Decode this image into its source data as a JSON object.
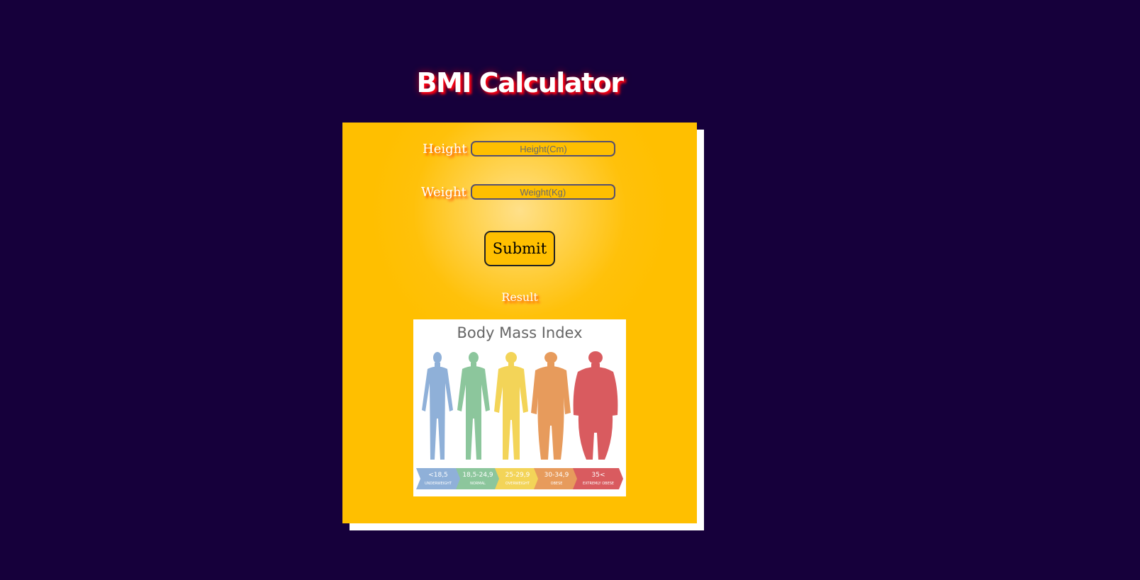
{
  "app": {
    "title": "BMI Calculator"
  },
  "form": {
    "height_label": "Height",
    "height_placeholder": "Height(Cm)",
    "height_value": "",
    "weight_label": "Weight",
    "weight_placeholder": "Weight(Kg)",
    "weight_value": "",
    "submit_label": "Submit",
    "result_text": "Result"
  },
  "bmi_image": {
    "title": "Body Mass Index",
    "categories": [
      {
        "range": "<18,5",
        "name": "UNDERWEIGHT",
        "color": "#8fb0d8"
      },
      {
        "range": "18,5-24,9",
        "name": "NORMAL",
        "color": "#8cc69c"
      },
      {
        "range": "25-29,9",
        "name": "OVERWEIGHT",
        "color": "#f3d458"
      },
      {
        "range": "30-34,9",
        "name": "OBESE",
        "color": "#e79b5c"
      },
      {
        "range": "35<",
        "name": "EXTREMLY OBESE",
        "color": "#d95b5f"
      }
    ]
  },
  "colors": {
    "background": "#16003b",
    "card": "#ffbf00",
    "title_shadow": "#ff0010",
    "label_shadow": "#ff4400"
  }
}
